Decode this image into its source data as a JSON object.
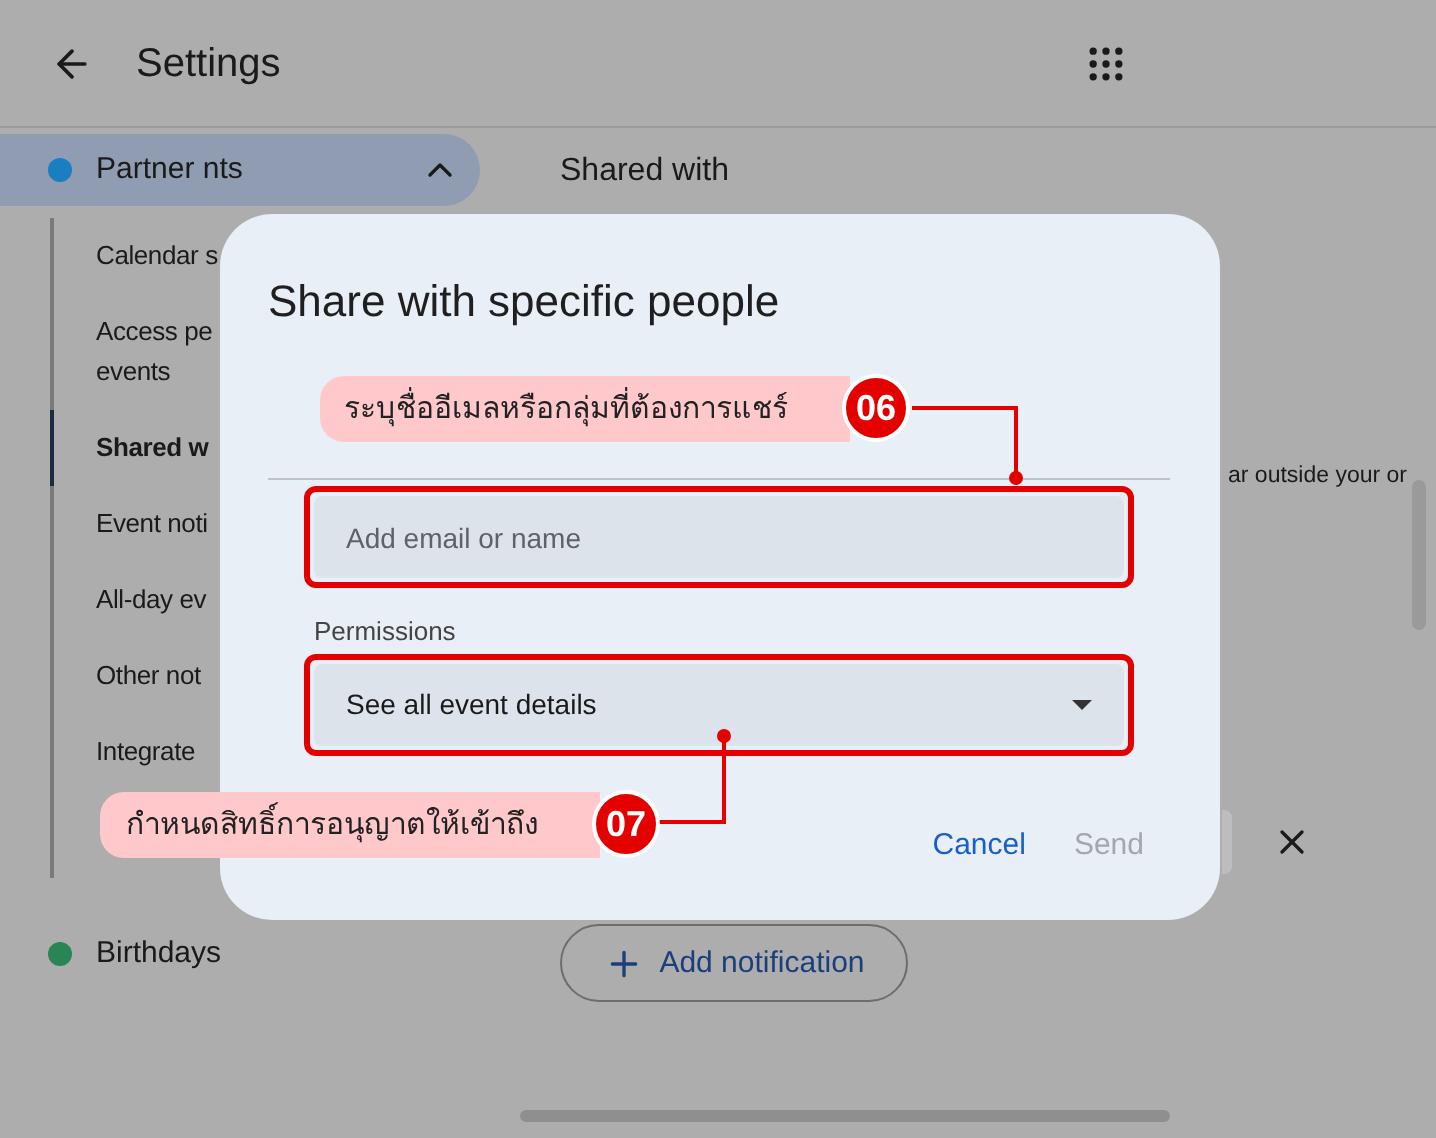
{
  "header": {
    "title": "Settings"
  },
  "sidebar": {
    "calendars": [
      {
        "label": "Partner nts",
        "color": "#1a7fc0",
        "selected": true,
        "expanded": true,
        "children": [
          {
            "label": "Calendar s",
            "selected": false
          },
          {
            "label": "Access pe\nevents",
            "selected": false
          },
          {
            "label": "Shared w",
            "selected": true
          },
          {
            "label": "Event noti",
            "selected": false
          },
          {
            "label": "All-day ev",
            "selected": false
          },
          {
            "label": "Other not",
            "selected": false
          },
          {
            "label": "Integrate",
            "selected": false
          }
        ]
      },
      {
        "label": "Birthdays",
        "color": "#2a8556",
        "selected": false,
        "expanded": false
      }
    ]
  },
  "main": {
    "section_title": "Shared with",
    "fragment": "ar outside your or",
    "add_button": "Add notification"
  },
  "dialog": {
    "title": "Share with specific people",
    "email_placeholder": "Add email or name",
    "permissions_label": "Permissions",
    "permissions_value": "See all event details",
    "buttons": [
      {
        "label": "Cancel",
        "disabled": false
      },
      {
        "label": "Send",
        "disabled": true
      }
    ]
  },
  "annotations": [
    {
      "number": "06",
      "text": "ระบุชื่ออีเมลหรือกลุ่มที่ต้องการแชร์"
    },
    {
      "number": "07",
      "text": "กำหนดสิทธิ์การอนุญาตให้เข้าถึง"
    }
  ]
}
